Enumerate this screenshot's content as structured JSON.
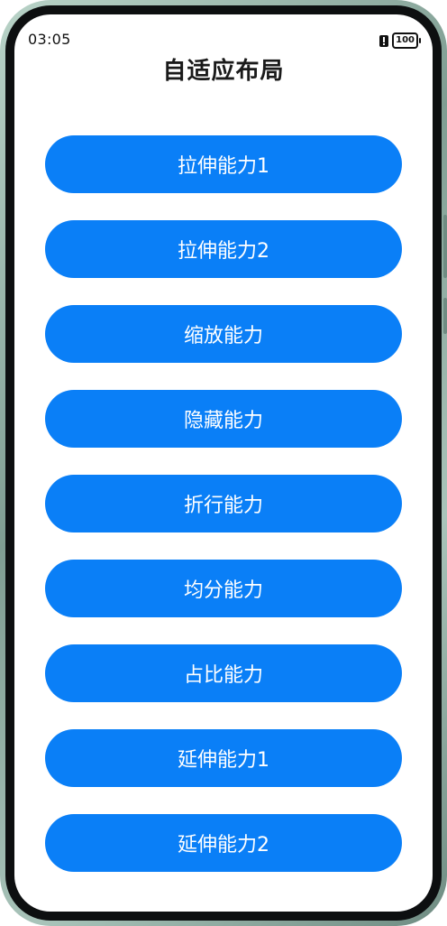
{
  "status_bar": {
    "time": "03:05",
    "battery": "100",
    "alert_icon": "notification-alert-icon"
  },
  "page": {
    "title": "自适应布局"
  },
  "buttons": [
    {
      "label": "拉伸能力1"
    },
    {
      "label": "拉伸能力2"
    },
    {
      "label": "缩放能力"
    },
    {
      "label": "隐藏能力"
    },
    {
      "label": "折行能力"
    },
    {
      "label": "均分能力"
    },
    {
      "label": "占比能力"
    },
    {
      "label": "延伸能力1"
    },
    {
      "label": "延伸能力2"
    }
  ],
  "colors": {
    "accent": "#0a7ff7",
    "background": "#ffffff",
    "title_text": "#1a1a1a"
  }
}
